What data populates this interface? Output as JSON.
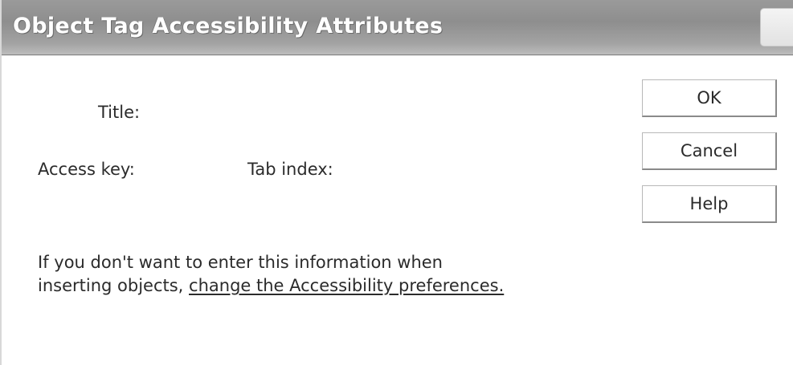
{
  "dialog": {
    "title": "Object Tag Accessibility Attributes"
  },
  "form": {
    "title_label": "Title:",
    "access_key_label": "Access key:",
    "tab_index_label": "Tab index:"
  },
  "buttons": {
    "ok": "OK",
    "cancel": "Cancel",
    "help": "Help"
  },
  "info": {
    "line1": "If you don't want to enter this information when",
    "line2_prefix": "inserting objects, ",
    "link_text": "change the Accessibility preferences."
  }
}
